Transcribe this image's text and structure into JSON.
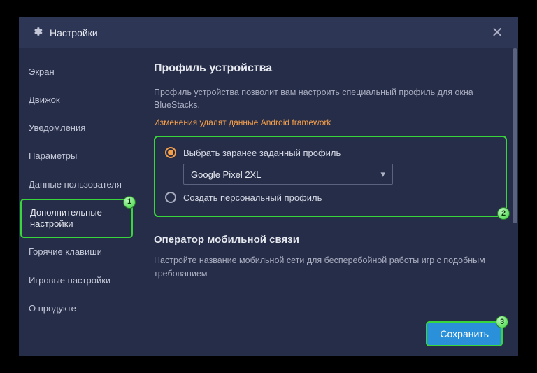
{
  "title": "Настройки",
  "sidebar": {
    "items": [
      {
        "label": "Экран"
      },
      {
        "label": "Движок"
      },
      {
        "label": "Уведомления"
      },
      {
        "label": "Параметры"
      },
      {
        "label": "Данные пользователя"
      },
      {
        "label": "Дополнительные настройки"
      },
      {
        "label": "Горячие клавиши"
      },
      {
        "label": "Игровые настройки"
      },
      {
        "label": "О продукте"
      }
    ],
    "active_index": 5
  },
  "main": {
    "heading": "Профиль устройства",
    "description": "Профиль устройства позволит вам настроить специальный профиль для окна BlueStacks.",
    "warning": "Изменения удалят данные Android framework",
    "radio_preset_label": "Выбрать заранее заданный профиль",
    "preset_value": "Google Pixel 2XL",
    "radio_custom_label": "Создать персональный профиль",
    "carrier_heading": "Оператор мобильной связи",
    "carrier_desc": "Настройте название мобильной сети для бесперебойной работы игр с подобным требованием"
  },
  "save_label": "Сохранить",
  "badges": {
    "b1": "1",
    "b2": "2",
    "b3": "3"
  }
}
